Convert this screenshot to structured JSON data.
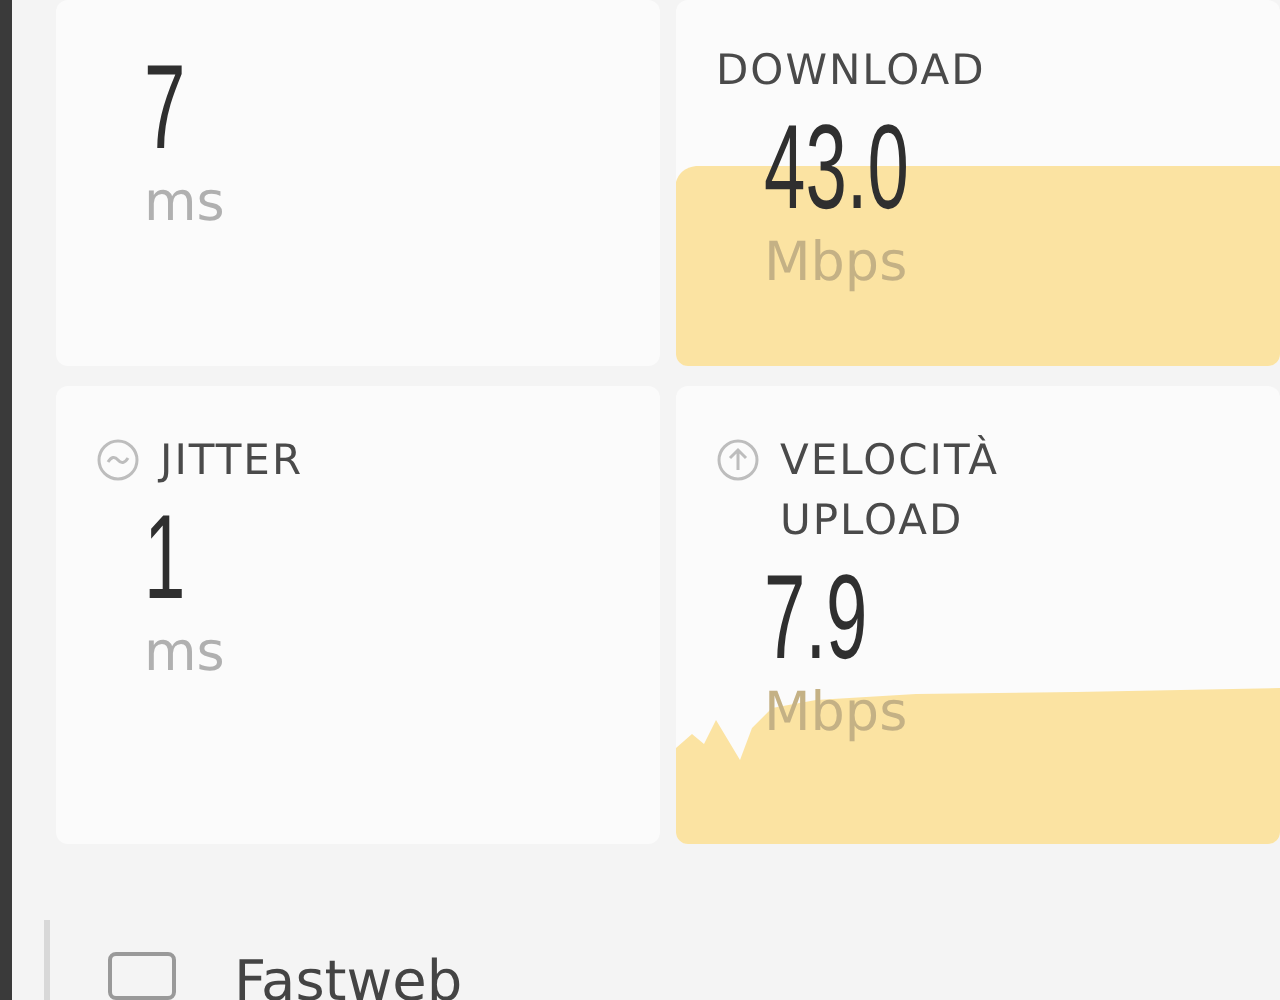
{
  "metrics": [
    {
      "kind": "ping",
      "value": "7",
      "unit": "ms"
    },
    {
      "kind": "download",
      "label": "DOWNLOAD",
      "value": "43.0",
      "unit": "Mbps"
    },
    {
      "kind": "jitter",
      "label": "JITTER",
      "value": "1",
      "unit": "ms"
    },
    {
      "kind": "upload",
      "label": "VELOCITÀ UPLOAD",
      "value": "7.9",
      "unit": "Mbps"
    }
  ],
  "provider": {
    "name": "Fastweb"
  }
}
